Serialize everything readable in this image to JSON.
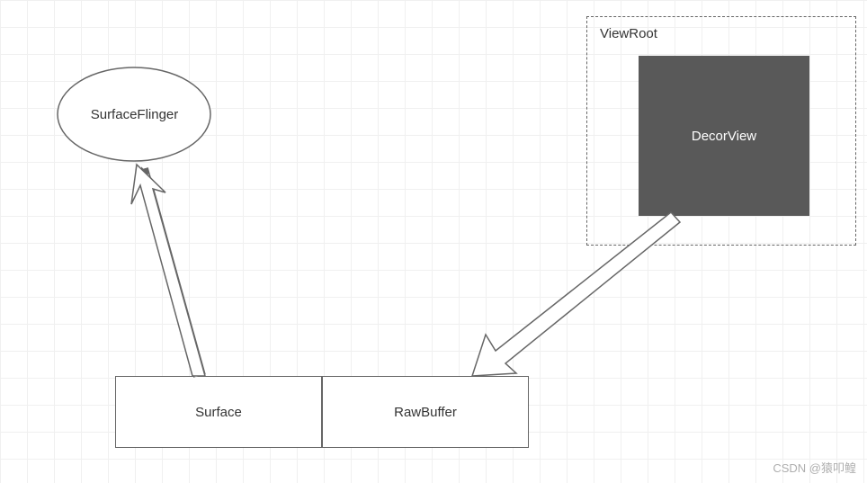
{
  "nodes": {
    "surfaceFlinger": "SurfaceFlinger",
    "viewRoot": "ViewRoot",
    "decorView": "DecorView",
    "surface": "Surface",
    "rawBuffer": "RawBuffer"
  },
  "watermark": "CSDN @猿叩鳇",
  "colors": {
    "decorViewFill": "#595959",
    "decorViewText": "#ffffff",
    "stroke": "#666666"
  }
}
